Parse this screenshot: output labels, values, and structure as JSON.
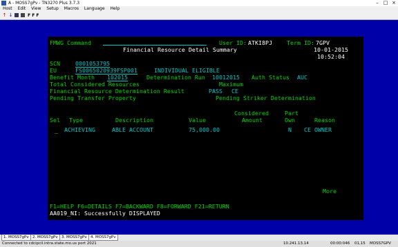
{
  "window": {
    "title": "A - MOSS7gPv - TN3270 Plus 3.7.3"
  },
  "menu": [
    "Host",
    "Edit",
    "View",
    "Setup",
    "Macros",
    "Language",
    "Help"
  ],
  "toolbar": {
    "font_label": "F F F"
  },
  "screen": {
    "header_left": "FMWG Command",
    "user_label": "User ID:",
    "user_id": "ATKI8PJ",
    "term_label": "Term ID:",
    "term_id": "7GPV",
    "title": "Financial Resource Detail Summary",
    "date": "10-01-2015",
    "time": "10:52:04",
    "scn_label": "SCN",
    "scn": "0001053795",
    "eu_label": "EU",
    "eu": "FS0065020939FSP001",
    "eu_desc": "INDIVIDUAL ELIGIBLE",
    "benefit_month_label": "Benefit Month",
    "benefit_month": "102015",
    "det_run_label": "Determination Run",
    "det_run": "10012015",
    "auth_label": "Auth Status",
    "auth_status": "AUC",
    "total_label": "Total Considered Resources",
    "max_label": "Maximum",
    "result_label": "Financial Resource Determination Result",
    "result_value": "PASS",
    "result_code": "CE",
    "pending_transfer_label": "Pending Transfer Property",
    "pending_striker_label": "Pending Striker Determination",
    "cols": {
      "sel": "Sel",
      "type": "Type",
      "description": "Description",
      "value": "Value",
      "considered": "Considered",
      "amount": "Amount",
      "part": "Part",
      "own": "Own",
      "reason": "Reason"
    },
    "row": {
      "sel": "_",
      "type": "ACHIEVING",
      "description": "ABLE ACCOUNT",
      "value": "75,000.00",
      "own": "N",
      "reason": "CE OWNER"
    },
    "more": "More",
    "fkeys": "F1=HELP F6=DETAILS F7=BACKWARD F8=FORWARD F21=RETURN",
    "message": "AA019_NI: Successfully DISPLAYED"
  },
  "tabs": [
    "1. MOSS7gPv",
    "2. MOSS7gPv",
    "3. MOSS7gPv",
    "4. MOSS7gPv"
  ],
  "status": {
    "connected": "Connected to cdcipcil.intra.state.mo.us port 2021",
    "ip": "10.241.13.14",
    "counter": "00:00:046",
    "pos": "01,15",
    "session": "MOSS7GPV"
  }
}
